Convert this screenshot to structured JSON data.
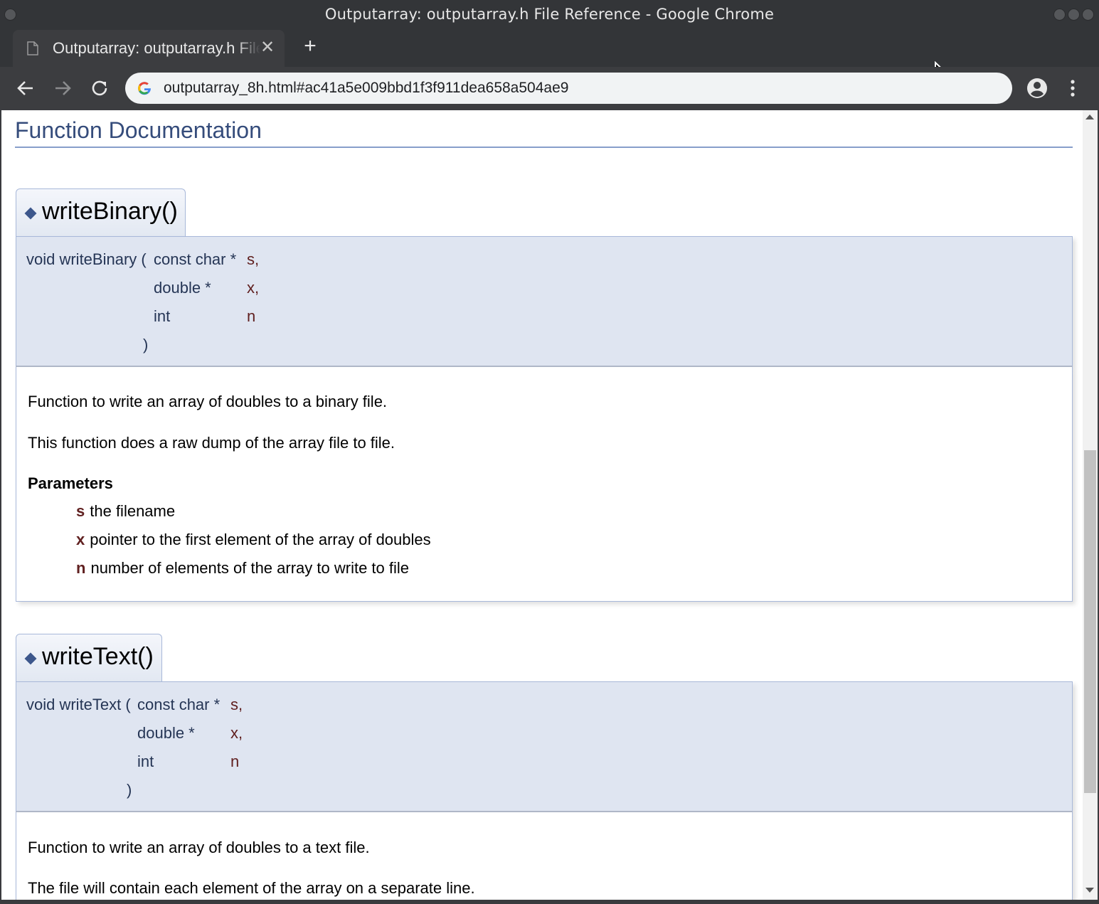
{
  "window": {
    "title": "Outputarray: outputarray.h File Reference - Google Chrome"
  },
  "tab": {
    "title": "Outputarray: outputarray.h File Reference",
    "close_glyph": "✕",
    "new_tab_glyph": "+"
  },
  "toolbar": {
    "url": "outputarray_8h.html#ac41a5e009bbd1f3f911dea658a504ae9"
  },
  "page": {
    "section_title": "Function Documentation",
    "functions": [
      {
        "name": "writeBinary()",
        "proto_prefix": "void writeBinary (",
        "params": [
          {
            "type": "const char *",
            "name": "s,"
          },
          {
            "type": "double *",
            "name": "x,"
          },
          {
            "type": "int",
            "name": "n"
          }
        ],
        "close": ")",
        "brief": "Function to write an array of doubles to a binary file.",
        "detail": "This function does a raw dump of the array file to file.",
        "params_heading": "Parameters",
        "param_docs": [
          {
            "name": "s",
            "desc": "the filename"
          },
          {
            "name": "x",
            "desc": "pointer to the first element of the array of doubles"
          },
          {
            "name": "n",
            "desc": "number of elements of the array to write to file"
          }
        ]
      },
      {
        "name": "writeText()",
        "proto_prefix": "void writeText (",
        "params": [
          {
            "type": "const char *",
            "name": "s,"
          },
          {
            "type": "double *",
            "name": "x,"
          },
          {
            "type": "int",
            "name": "n"
          }
        ],
        "close": ")",
        "brief": "Function to write an array of doubles to a text file.",
        "detail": "The file will contain each element of the array on a separate line."
      }
    ]
  },
  "colors": {
    "title_blue": "#354c7b",
    "param_red": "#602020",
    "proto_bg": "#dfe5f1"
  }
}
